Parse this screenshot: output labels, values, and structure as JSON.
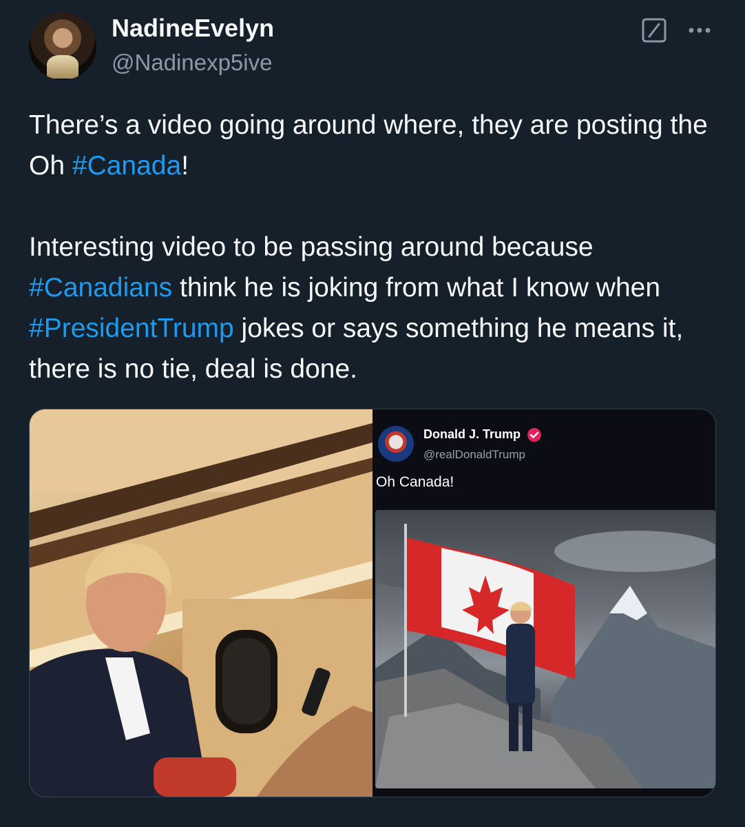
{
  "author": {
    "display_name": "NadineEvelyn",
    "handle": "@Nadinexp5ive"
  },
  "icons": {
    "grok": "grok-icon",
    "more": "more-icon",
    "verified": "verified-badge-icon"
  },
  "tweet": {
    "p1_text_a": "There’s a video going around where, they are posting the Oh ",
    "p1_tag": "#Canada",
    "p1_text_b": "!",
    "p2_text_a": "Interesting video to be passing around because ",
    "p2_tag_canadians": "#Canadians",
    "p2_text_b": " think he is joking from what I know when ",
    "p2_tag_trump": "#PresidentTrump",
    "p2_text_c": " jokes or says something he means it, there is no tie, deal is done."
  },
  "embedded_post": {
    "name": "Donald J. Trump",
    "handle": "@realDonaldTrump",
    "text": "Oh Canada!"
  },
  "colors": {
    "background": "#15202b",
    "text": "#f7f9f9",
    "secondary": "#8b98a5",
    "link": "#1d9bf0",
    "border": "#38444d"
  }
}
